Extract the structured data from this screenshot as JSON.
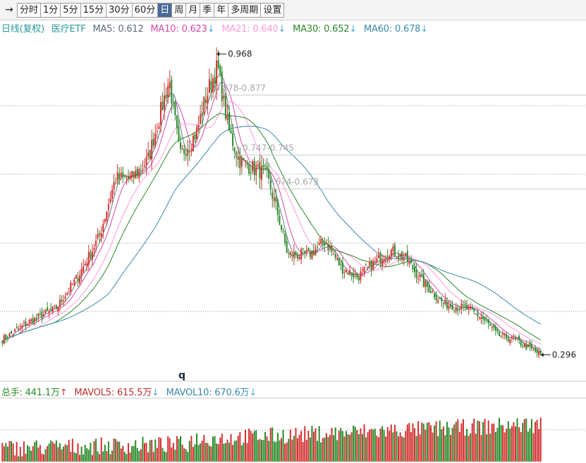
{
  "toolbar": {
    "arrow_icon": "→",
    "tabs": [
      "分时",
      "1分",
      "5分",
      "15分",
      "30分",
      "60分",
      "日",
      "周",
      "月",
      "季",
      "年",
      "多周期",
      "设置"
    ],
    "active_tab": "日"
  },
  "ma_header": {
    "chart_label": "日线(复权)",
    "security": "医疗ETF",
    "ma5": "MA5: 0.612",
    "ma10": "MA10: 0.623",
    "ma21": "MA21: 0.640",
    "ma30": "MA30: 0.652",
    "ma60": "MA60: 0.678",
    "down_arrow": "↓",
    "colors": {
      "label": "#2a9a9a",
      "ma5": "#5a6a7a",
      "ma10": "#d44aa8",
      "ma21": "#ff9ad8",
      "ma30": "#2a8a2a",
      "ma60": "#3a8aa8"
    }
  },
  "vol_header": {
    "total": "总手: 441.1万",
    "up_arrow": "↑",
    "mavol5": "MAVOL5: 615.5万",
    "mavol10": "MAVOL10: 670.6万",
    "down_arrow": "↓",
    "colors": {
      "total": "#2a8a2a",
      "up": "#d43030",
      "mavol5": "#c03030",
      "mavol10": "#3a8aa8",
      "arrow": "#4aa8d8"
    }
  },
  "annotations": {
    "high": "0.968",
    "low": "0.296",
    "cursor_mark": "q",
    "fib": [
      "0.878-0.877",
      "0.747-0.745",
      "0.674-0.673"
    ]
  },
  "chart_data": {
    "type": "candlestick",
    "ylim": [
      0.27,
      1.01
    ],
    "grid": "dotted horizontal",
    "series_keypoints": [
      {
        "t": 0,
        "v": 0.33
      },
      {
        "t": 0.05,
        "v": 0.37
      },
      {
        "t": 0.1,
        "v": 0.4
      },
      {
        "t": 0.14,
        "v": 0.47
      },
      {
        "t": 0.18,
        "v": 0.56
      },
      {
        "t": 0.21,
        "v": 0.69
      },
      {
        "t": 0.24,
        "v": 0.69
      },
      {
        "t": 0.27,
        "v": 0.73
      },
      {
        "t": 0.31,
        "v": 0.91
      },
      {
        "t": 0.33,
        "v": 0.74
      },
      {
        "t": 0.36,
        "v": 0.79
      },
      {
        "t": 0.38,
        "v": 0.88
      },
      {
        "t": 0.4,
        "v": 0.94
      },
      {
        "t": 0.42,
        "v": 0.8
      },
      {
        "t": 0.44,
        "v": 0.73
      },
      {
        "t": 0.47,
        "v": 0.71
      },
      {
        "t": 0.49,
        "v": 0.7
      },
      {
        "t": 0.51,
        "v": 0.62
      },
      {
        "t": 0.53,
        "v": 0.52
      },
      {
        "t": 0.57,
        "v": 0.52
      },
      {
        "t": 0.6,
        "v": 0.55
      },
      {
        "t": 0.63,
        "v": 0.49
      },
      {
        "t": 0.66,
        "v": 0.47
      },
      {
        "t": 0.69,
        "v": 0.5
      },
      {
        "t": 0.72,
        "v": 0.53
      },
      {
        "t": 0.75,
        "v": 0.51
      },
      {
        "t": 0.78,
        "v": 0.46
      },
      {
        "t": 0.82,
        "v": 0.41
      },
      {
        "t": 0.86,
        "v": 0.4
      },
      {
        "t": 0.89,
        "v": 0.38
      },
      {
        "t": 0.92,
        "v": 0.34
      },
      {
        "t": 0.95,
        "v": 0.33
      },
      {
        "t": 0.98,
        "v": 0.31
      },
      {
        "t": 1.0,
        "v": 0.296
      }
    ],
    "high": 0.968,
    "low": 0.296
  }
}
